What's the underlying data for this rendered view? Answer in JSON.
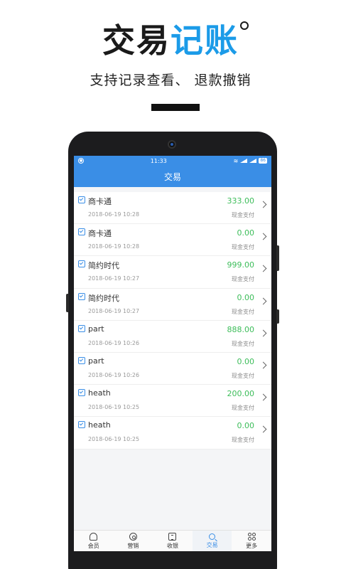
{
  "headline": {
    "title_part1": "交易",
    "title_part2": "记账",
    "subtitle": "支持记录查看、 退款撤销"
  },
  "status_bar": {
    "time": "11:33",
    "battery": "86"
  },
  "navbar": {
    "title": "交易"
  },
  "transactions": [
    {
      "name": "商卡通",
      "time": "2018-06-19 10:28",
      "amount": "333.00",
      "pay": "现金支付"
    },
    {
      "name": "商卡通",
      "time": "2018-06-19 10:28",
      "amount": "0.00",
      "pay": "现金支付"
    },
    {
      "name": "简约时代",
      "time": "2018-06-19 10:27",
      "amount": "999.00",
      "pay": "现金支付"
    },
    {
      "name": "简约时代",
      "time": "2018-06-19 10:27",
      "amount": "0.00",
      "pay": "现金支付"
    },
    {
      "name": "part",
      "time": "2018-06-19 10:26",
      "amount": "888.00",
      "pay": "现金支付"
    },
    {
      "name": "part",
      "time": "2018-06-19 10:26",
      "amount": "0.00",
      "pay": "现金支付"
    },
    {
      "name": "heath",
      "time": "2018-06-19 10:25",
      "amount": "200.00",
      "pay": "现金支付"
    },
    {
      "name": "heath",
      "time": "2018-06-19 10:25",
      "amount": "0.00",
      "pay": "现金支付"
    }
  ],
  "tabs": [
    {
      "label": "会员",
      "icon": "member-icon"
    },
    {
      "label": "营销",
      "icon": "marketing-icon"
    },
    {
      "label": "收银",
      "icon": "cashier-icon"
    },
    {
      "label": "交易",
      "icon": "search-icon",
      "active": true
    },
    {
      "label": "更多",
      "icon": "more-icon"
    }
  ],
  "colors": {
    "accent": "#3a8ee6",
    "amount_green": "#3dbd5a",
    "title_blue": "#1b9be8"
  }
}
